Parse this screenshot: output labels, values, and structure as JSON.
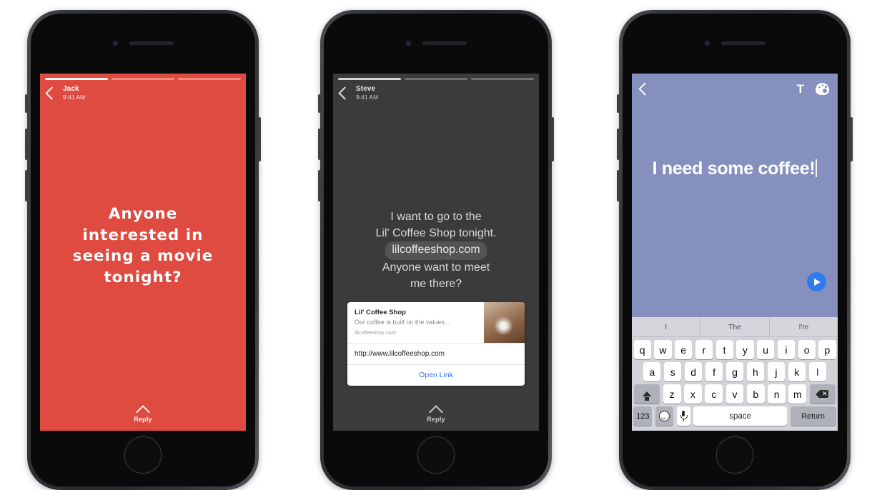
{
  "phones": [
    {
      "id": "story-jack",
      "screen_type": "story-view",
      "background_color": "#e04b41",
      "progress_segments": 3,
      "active_segment": 1,
      "back_icon": "chevron-left-icon",
      "author": "Jack",
      "timestamp": "9:41 AM",
      "story_text": "Anyone\ninterested in\nseeing a movie\ntonight?",
      "footer": {
        "icon": "chevron-up-icon",
        "label": "Reply"
      }
    },
    {
      "id": "story-steve",
      "screen_type": "story-view-with-link",
      "background_color": "#3b3b3b",
      "progress_segments": 3,
      "active_segment": 1,
      "back_icon": "chevron-left-icon",
      "author": "Steve",
      "timestamp": "9:41 AM",
      "message_lines": [
        "I want to go to the",
        "Lil' Coffee Shop tonight."
      ],
      "message_link": "lilcoffeeshop.com",
      "message_lines_after": [
        "Anyone want to meet",
        "me there?"
      ],
      "link_card": {
        "title": "Lil' Coffee Shop",
        "description": "Our coffee is built on the values...",
        "domain": "lilcoffeeshop.com",
        "thumbnail": "coffee-cup-photo",
        "url": "http://www.lilcoffeeshop.com",
        "action_label": "Open Link",
        "action_color": "#3478f6"
      },
      "footer": {
        "icon": "chevron-up-icon",
        "label": "Reply"
      }
    },
    {
      "id": "compose",
      "screen_type": "compose-editor",
      "background_color": "#8690bf",
      "back_icon": "chevron-left-icon",
      "tools": [
        {
          "name": "text-tool",
          "label": "T"
        },
        {
          "name": "color-palette-tool",
          "label": ""
        }
      ],
      "composed_text": "I need some coffee!",
      "caret_visible": true,
      "send_button": {
        "icon": "send-icon",
        "color": "#2e7bf0"
      },
      "keyboard": {
        "predictions": [
          "I",
          "The",
          "I'm"
        ],
        "row1": [
          "q",
          "w",
          "e",
          "r",
          "t",
          "y",
          "u",
          "i",
          "o",
          "p"
        ],
        "row2": [
          "a",
          "s",
          "d",
          "f",
          "g",
          "h",
          "j",
          "k",
          "l"
        ],
        "row3_letters": [
          "z",
          "x",
          "c",
          "v",
          "b",
          "n",
          "m"
        ],
        "shift_label": "shift",
        "delete_label": "delete",
        "numbers_label": "123",
        "emoji_label": "emoji",
        "dictation_label": "dictation",
        "space_label": "space",
        "return_label": "Return"
      }
    }
  ]
}
